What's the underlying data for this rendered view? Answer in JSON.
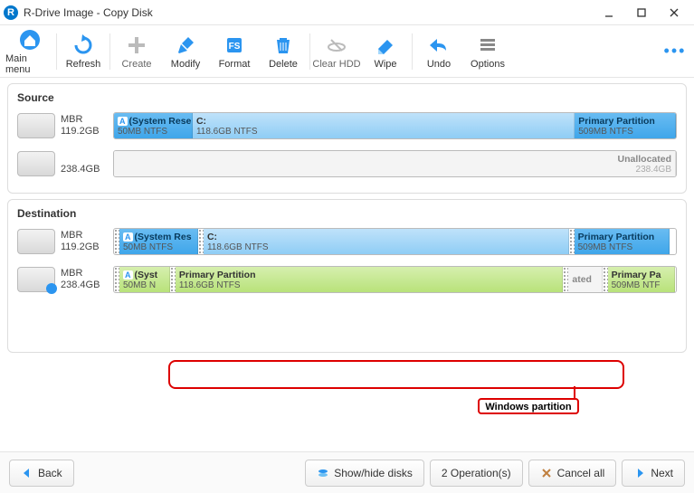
{
  "title": "R-Drive Image - Copy Disk",
  "logo_letter": "R",
  "toolbar": {
    "main_menu": "Main menu",
    "refresh": "Refresh",
    "create": "Create",
    "modify": "Modify",
    "format": "Format",
    "delete": "Delete",
    "clear_hdd": "Clear HDD",
    "wipe": "Wipe",
    "undo": "Undo",
    "options": "Options"
  },
  "source": {
    "title": "Source",
    "disk1": {
      "scheme": "MBR",
      "size": "119.2GB",
      "p1": {
        "title": "(System Rese",
        "sub": "50MB NTFS",
        "badge": "A"
      },
      "p2": {
        "title": "C:",
        "sub": "118.6GB NTFS"
      },
      "p3": {
        "title": "Primary Partition",
        "sub": "509MB NTFS"
      }
    },
    "disk2": {
      "size": "238.4GB",
      "p1": {
        "title": "Unallocated",
        "sub": "238.4GB"
      }
    }
  },
  "destination": {
    "title": "Destination",
    "disk1": {
      "scheme": "MBR",
      "size": "119.2GB",
      "p1": {
        "title": "(System Res",
        "sub": "50MB NTFS",
        "badge": "A"
      },
      "p2": {
        "title": "C:",
        "sub": "118.6GB NTFS"
      },
      "p3": {
        "title": "Primary Partition",
        "sub": "509MB NTFS"
      }
    },
    "disk2": {
      "scheme": "MBR",
      "size": "238.4GB",
      "p1": {
        "title": "(Syst",
        "sub": "50MB N",
        "badge": "A"
      },
      "p2": {
        "title": "Primary Partition",
        "sub": "118.6GB NTFS"
      },
      "p3": {
        "title": "ated",
        "sub": ""
      },
      "p4": {
        "title": "Primary Pa",
        "sub": "509MB NTF"
      }
    }
  },
  "annotation": {
    "label": "Windows partition"
  },
  "footer": {
    "back": "Back",
    "show_hide": "Show/hide disks",
    "operations": "2 Operation(s)",
    "cancel_all": "Cancel all",
    "next": "Next"
  }
}
